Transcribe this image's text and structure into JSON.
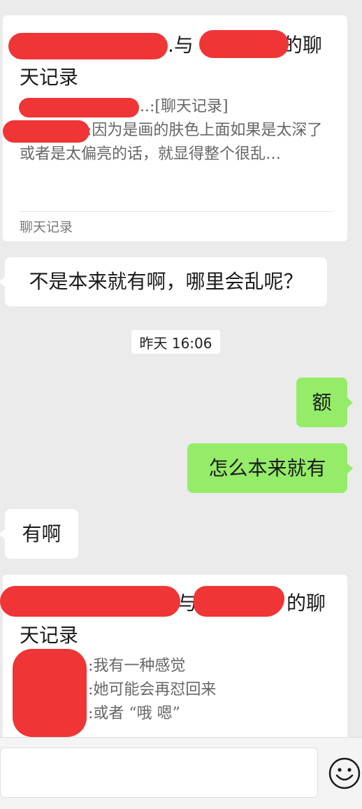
{
  "messages": {
    "card1": {
      "title_mid": ".与",
      "title_end": "的聊",
      "title_line2": "天记录",
      "line1": "..:[聊天记录]",
      "line2_text": ":因为是画的肤色上面如果是太深了或者是太偏亮的话，就显得整个很乱…",
      "footer": "聊天记录"
    },
    "bubble1": "不是本来就有啊，哪里会乱呢？",
    "timestamp": "昨天 16:06",
    "bubble2": "额",
    "bubble3": "怎么本来就有",
    "bubble4": "有啊",
    "card2": {
      "title_mid": "与",
      "title_end": "的聊",
      "title_line2": "天记录",
      "line1": ":我有一种感觉",
      "line2": ":她可能会再怼回来",
      "line3": ":或者 “哦 嗯”"
    }
  },
  "colors": {
    "redaction": "#ef3535",
    "own_bubble": "#95ec69",
    "background": "#ebebeb"
  },
  "icons": {
    "emoji": "smiley-face-icon"
  }
}
